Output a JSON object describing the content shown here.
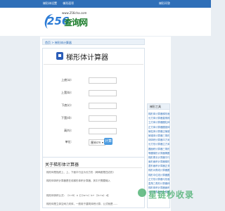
{
  "topbar": {
    "links": [
      "梯形体设置",
      "梯形面积"
    ],
    "right": "梯形问答"
  },
  "logo": {
    "url": "www.256cha.com",
    "number": "256",
    "cn": "查询网"
  },
  "breadcrumb": "首页 > 梯形体计算器",
  "title": "梯形体计算器",
  "form": {
    "rows": [
      {
        "label": "上底(a):"
      },
      {
        "label": "上宽(b):"
      },
      {
        "label": "下底(c):"
      },
      {
        "label": "下宽(d):"
      },
      {
        "label": "高(h):"
      }
    ],
    "unit_label": "单位:",
    "unit_value": "厘米cm",
    "calc_button": "计算"
  },
  "about": {
    "title": "关于梯形体计算器",
    "paragraphs": [
      "梯形体是指底上、上、下面平行且为长方形（两两都是四边形）",
      "梯形体体积计算器是在线梯形体积计算器，其中只需要输入",
      "梯形体体积公式：（h÷6）×【（2a+c）b+（2c+a）d】",
      "梯形体是立体空间几何体，一般用于建筑体积计算，公式就是……"
    ]
  },
  "sidebar": {
    "title": "梯形工具",
    "items": [
      [
        "梯形体计算器",
        "梯形面积计算器"
      ],
      [
        "长方体计算器",
        "直角梯形计算器"
      ],
      [
        "立方体计算器",
        "圆柱体计算器"
      ],
      [
        "正方体计算器",
        "圆锥体积计算器"
      ],
      [
        "棱柱体计算器",
        "正棱锥计算器"
      ],
      [
        "棱锥体计算器",
        "三角形计算器"
      ],
      [
        "球体积计算器",
        "平方米计算器"
      ],
      [
        "长方形计算器",
        "立方米计算器"
      ],
      [
        "圆面积计算器",
        "三角形面积计算器"
      ],
      [
        "等腰梯形计算器",
        "椭圆面积计算器"
      ],
      [
        "梯形周长计算器",
        "平行四边形计算器"
      ],
      [
        "扇形面积计算器",
        "梯形高计算器"
      ],
      [
        "菱形面积计算器",
        "正多边形计算器"
      ],
      [
        "梯形对角线计算器",
        "圆周长计算器"
      ],
      [
        "梯形中位线计算器",
        "圆环面积计算器"
      ],
      [
        "正方形计算器",
        "弓形面积计算器"
      ],
      [
        "直角三角形计算器",
        "体积计算器"
      ],
      [
        "梯形体积计算器",
        "面积计算器"
      ],
      [
        "长方体表面积计算器",
        "表面积计算器"
      ]
    ]
  },
  "watermark": "星链秒收录"
}
